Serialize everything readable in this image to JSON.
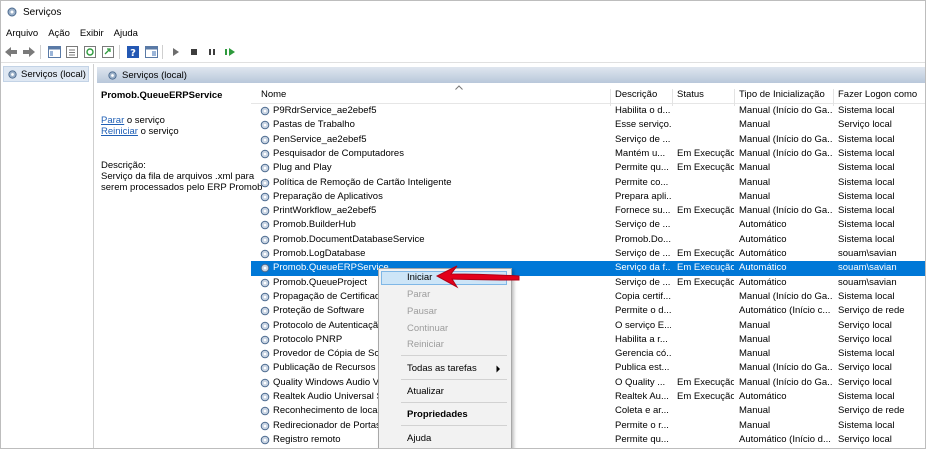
{
  "window": {
    "title": "Serviços"
  },
  "menu": [
    "Arquivo",
    "Ação",
    "Exibir",
    "Ajuda"
  ],
  "left_pane": {
    "item": "Serviços (local)"
  },
  "right_header": "Serviços (local)",
  "detail": {
    "service_name": "Promob.QueueERPService",
    "stop_link": "Parar",
    "stop_suffix": " o serviço",
    "restart_link": "Reiniciar",
    "restart_suffix": " o serviço",
    "desc_label": "Descrição:",
    "desc_lines": [
      "Serviço da fila de arquivos .xml para",
      "serem processados pelo ERP Promob"
    ]
  },
  "columns": [
    "Nome",
    "Descrição",
    "Status",
    "Tipo de Inicialização",
    "Fazer Logon como"
  ],
  "rows": [
    {
      "name": "P9RdrService_ae2ebef5",
      "desc": "Habilita o d...",
      "status": "",
      "start": "Manual (Início do Ga...",
      "logon": "Sistema local"
    },
    {
      "name": "Pastas de Trabalho",
      "desc": "Esse serviço...",
      "status": "",
      "start": "Manual",
      "logon": "Serviço local"
    },
    {
      "name": "PenService_ae2ebef5",
      "desc": "Serviço de ...",
      "status": "",
      "start": "Manual (Início do Ga...",
      "logon": "Sistema local"
    },
    {
      "name": "Pesquisador de Computadores",
      "desc": "Mantém u...",
      "status": "Em Execução",
      "start": "Manual (Início do Ga...",
      "logon": "Sistema local"
    },
    {
      "name": "Plug and Play",
      "desc": "Permite qu...",
      "status": "Em Execução",
      "start": "Manual",
      "logon": "Sistema local"
    },
    {
      "name": "Política de Remoção de Cartão Inteligente",
      "desc": "Permite co...",
      "status": "",
      "start": "Manual",
      "logon": "Sistema local"
    },
    {
      "name": "Preparação de Aplicativos",
      "desc": "Prepara apli...",
      "status": "",
      "start": "Manual",
      "logon": "Sistema local"
    },
    {
      "name": "PrintWorkflow_ae2ebef5",
      "desc": "Fornece su...",
      "status": "Em Execução",
      "start": "Manual (Início do Ga...",
      "logon": "Sistema local"
    },
    {
      "name": "Promob.BuilderHub",
      "desc": "Serviço de ...",
      "status": "",
      "start": "Automático",
      "logon": "Sistema local"
    },
    {
      "name": "Promob.DocumentDatabaseService",
      "desc": "Promob.Do...",
      "status": "",
      "start": "Automático",
      "logon": "Sistema local"
    },
    {
      "name": "Promob.LogDatabase",
      "desc": "Serviço de ...",
      "status": "Em Execução",
      "start": "Automático",
      "logon": "souam\\savian"
    },
    {
      "name": "Promob.QueueERPService",
      "desc": "Serviço da f...",
      "status": "Em Execução",
      "start": "Automático",
      "logon": "souam\\savian"
    },
    {
      "name": "Promob.QueueProject",
      "desc": "Serviço de ...",
      "status": "Em Execução",
      "start": "Automático",
      "logon": "souam\\savian"
    },
    {
      "name": "Propagação de Certificado",
      "desc": "Copia certif...",
      "status": "",
      "start": "Manual (Início do Ga...",
      "logon": "Sistema local"
    },
    {
      "name": "Proteção de Software",
      "desc": "Permite o d...",
      "status": "",
      "start": "Automático (Início c...",
      "logon": "Serviço de rede"
    },
    {
      "name": "Protocolo de Autenticação",
      "desc": "O serviço E...",
      "status": "",
      "start": "Manual",
      "logon": "Serviço local"
    },
    {
      "name": "Protocolo PNRP",
      "desc": "Habilita a r...",
      "status": "",
      "start": "Manual",
      "logon": "Serviço local"
    },
    {
      "name": "Provedor de Cópia de Som",
      "desc": "Gerencia có...",
      "status": "",
      "start": "Manual",
      "logon": "Sistema local"
    },
    {
      "name": "Publicação de Recursos de",
      "desc": "Publica est...",
      "status": "",
      "start": "Manual (Início do Ga...",
      "logon": "Serviço local"
    },
    {
      "name": "Quality Windows Audio Vi",
      "desc": "O Quality ...",
      "status": "Em Execução",
      "start": "Manual (Início do Ga...",
      "logon": "Serviço local"
    },
    {
      "name": "Realtek Audio Universal Se",
      "desc": "Realtek Au...",
      "status": "Em Execução",
      "start": "Automático",
      "logon": "Sistema local"
    },
    {
      "name": "Reconhecimento de locais",
      "desc": "Coleta e ar...",
      "status": "",
      "start": "Manual",
      "logon": "Serviço de rede"
    },
    {
      "name": "Redirecionador de Portas de Área de Trabalho",
      "desc": "Permite o r...",
      "status": "",
      "start": "Manual",
      "logon": "Sistema local"
    },
    {
      "name": "Registro remoto",
      "desc": "Permite qu...",
      "status": "",
      "start": "Automático (Início d...",
      "logon": "Serviço local"
    }
  ],
  "selected_row": 11,
  "context_menu": {
    "iniciar": "Iniciar",
    "parar": "Parar",
    "pausar": "Pausar",
    "continuar": "Continuar",
    "reiniciar": "Reiniciar",
    "todas": "Todas as tarefas",
    "atualizar": "Atualizar",
    "propriedades": "Propriedades",
    "ajuda": "Ajuda"
  },
  "colors": {
    "selection": "#0078d7",
    "link": "#1f5fb5",
    "annotation_arrow": "#e3001b"
  }
}
